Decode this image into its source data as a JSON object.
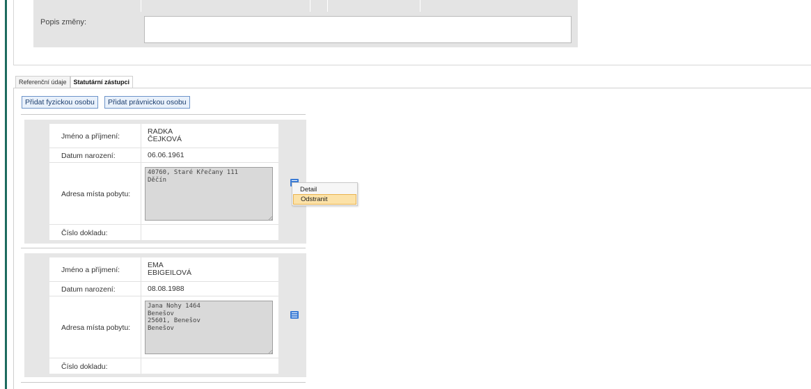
{
  "form": {
    "popis_label": "Popis změny:",
    "popis_value": ""
  },
  "tabs": [
    {
      "label": "Referenční údaje",
      "active": false
    },
    {
      "label": "Statutární zástupci",
      "active": true
    }
  ],
  "actions": {
    "add_person": "Přidat fyzickou osobu",
    "add_company": "Přidat právnickou osobu"
  },
  "labels": {
    "name": "Jméno a příjmení:",
    "birth": "Datum narození:",
    "address": "Adresa místa pobytu:",
    "document": "Číslo dokladu:"
  },
  "persons": [
    {
      "name_first": "RADKA",
      "name_last": "ČEJKOVÁ",
      "birth_date": "06.06.1961",
      "address": "40760, Staré Křečany 111\nDěčín",
      "document": ""
    },
    {
      "name_first": "EMA",
      "name_last": "EBIGEILOVÁ",
      "birth_date": "08.08.1988",
      "address": "Jana Nohy 1464\nBenešov\n25601, Benešov\nBenešov",
      "document": ""
    }
  ],
  "context_menu": {
    "items": [
      "Detail",
      "Odstranit"
    ],
    "highlighted": "Odstranit"
  },
  "colors": {
    "accent_bar": "#1d6b5e",
    "button_border": "#6d94c9",
    "menu_icon": "#3a7bd5",
    "menu_highlight": "#fce2a8"
  }
}
